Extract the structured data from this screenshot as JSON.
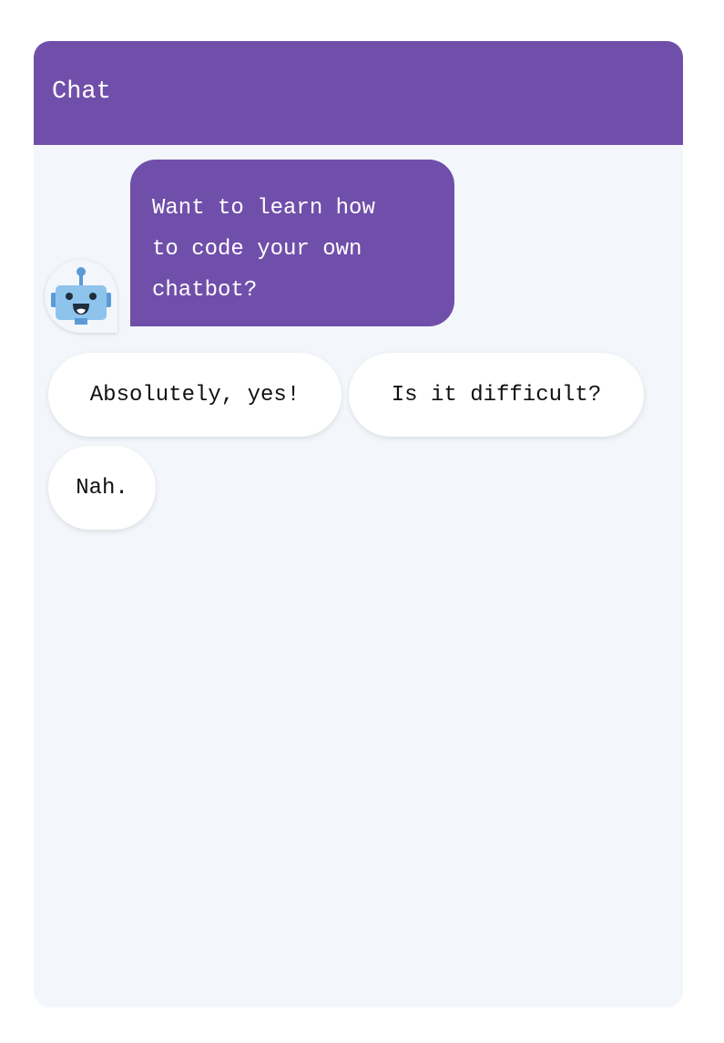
{
  "header": {
    "title": "Chat"
  },
  "bot": {
    "avatar_icon": "robot-icon",
    "message_lines": [
      "Want to learn how",
      "to code your own",
      "chatbot?"
    ]
  },
  "quick_replies": [
    {
      "label": "Absolutely, yes!"
    },
    {
      "label": "Is it difficult?"
    },
    {
      "label": "Nah."
    }
  ],
  "colors": {
    "accent": "#704faa",
    "chat_background": "#f3f6fa",
    "reply_background": "#ffffff",
    "page_background": "#ffffff"
  }
}
